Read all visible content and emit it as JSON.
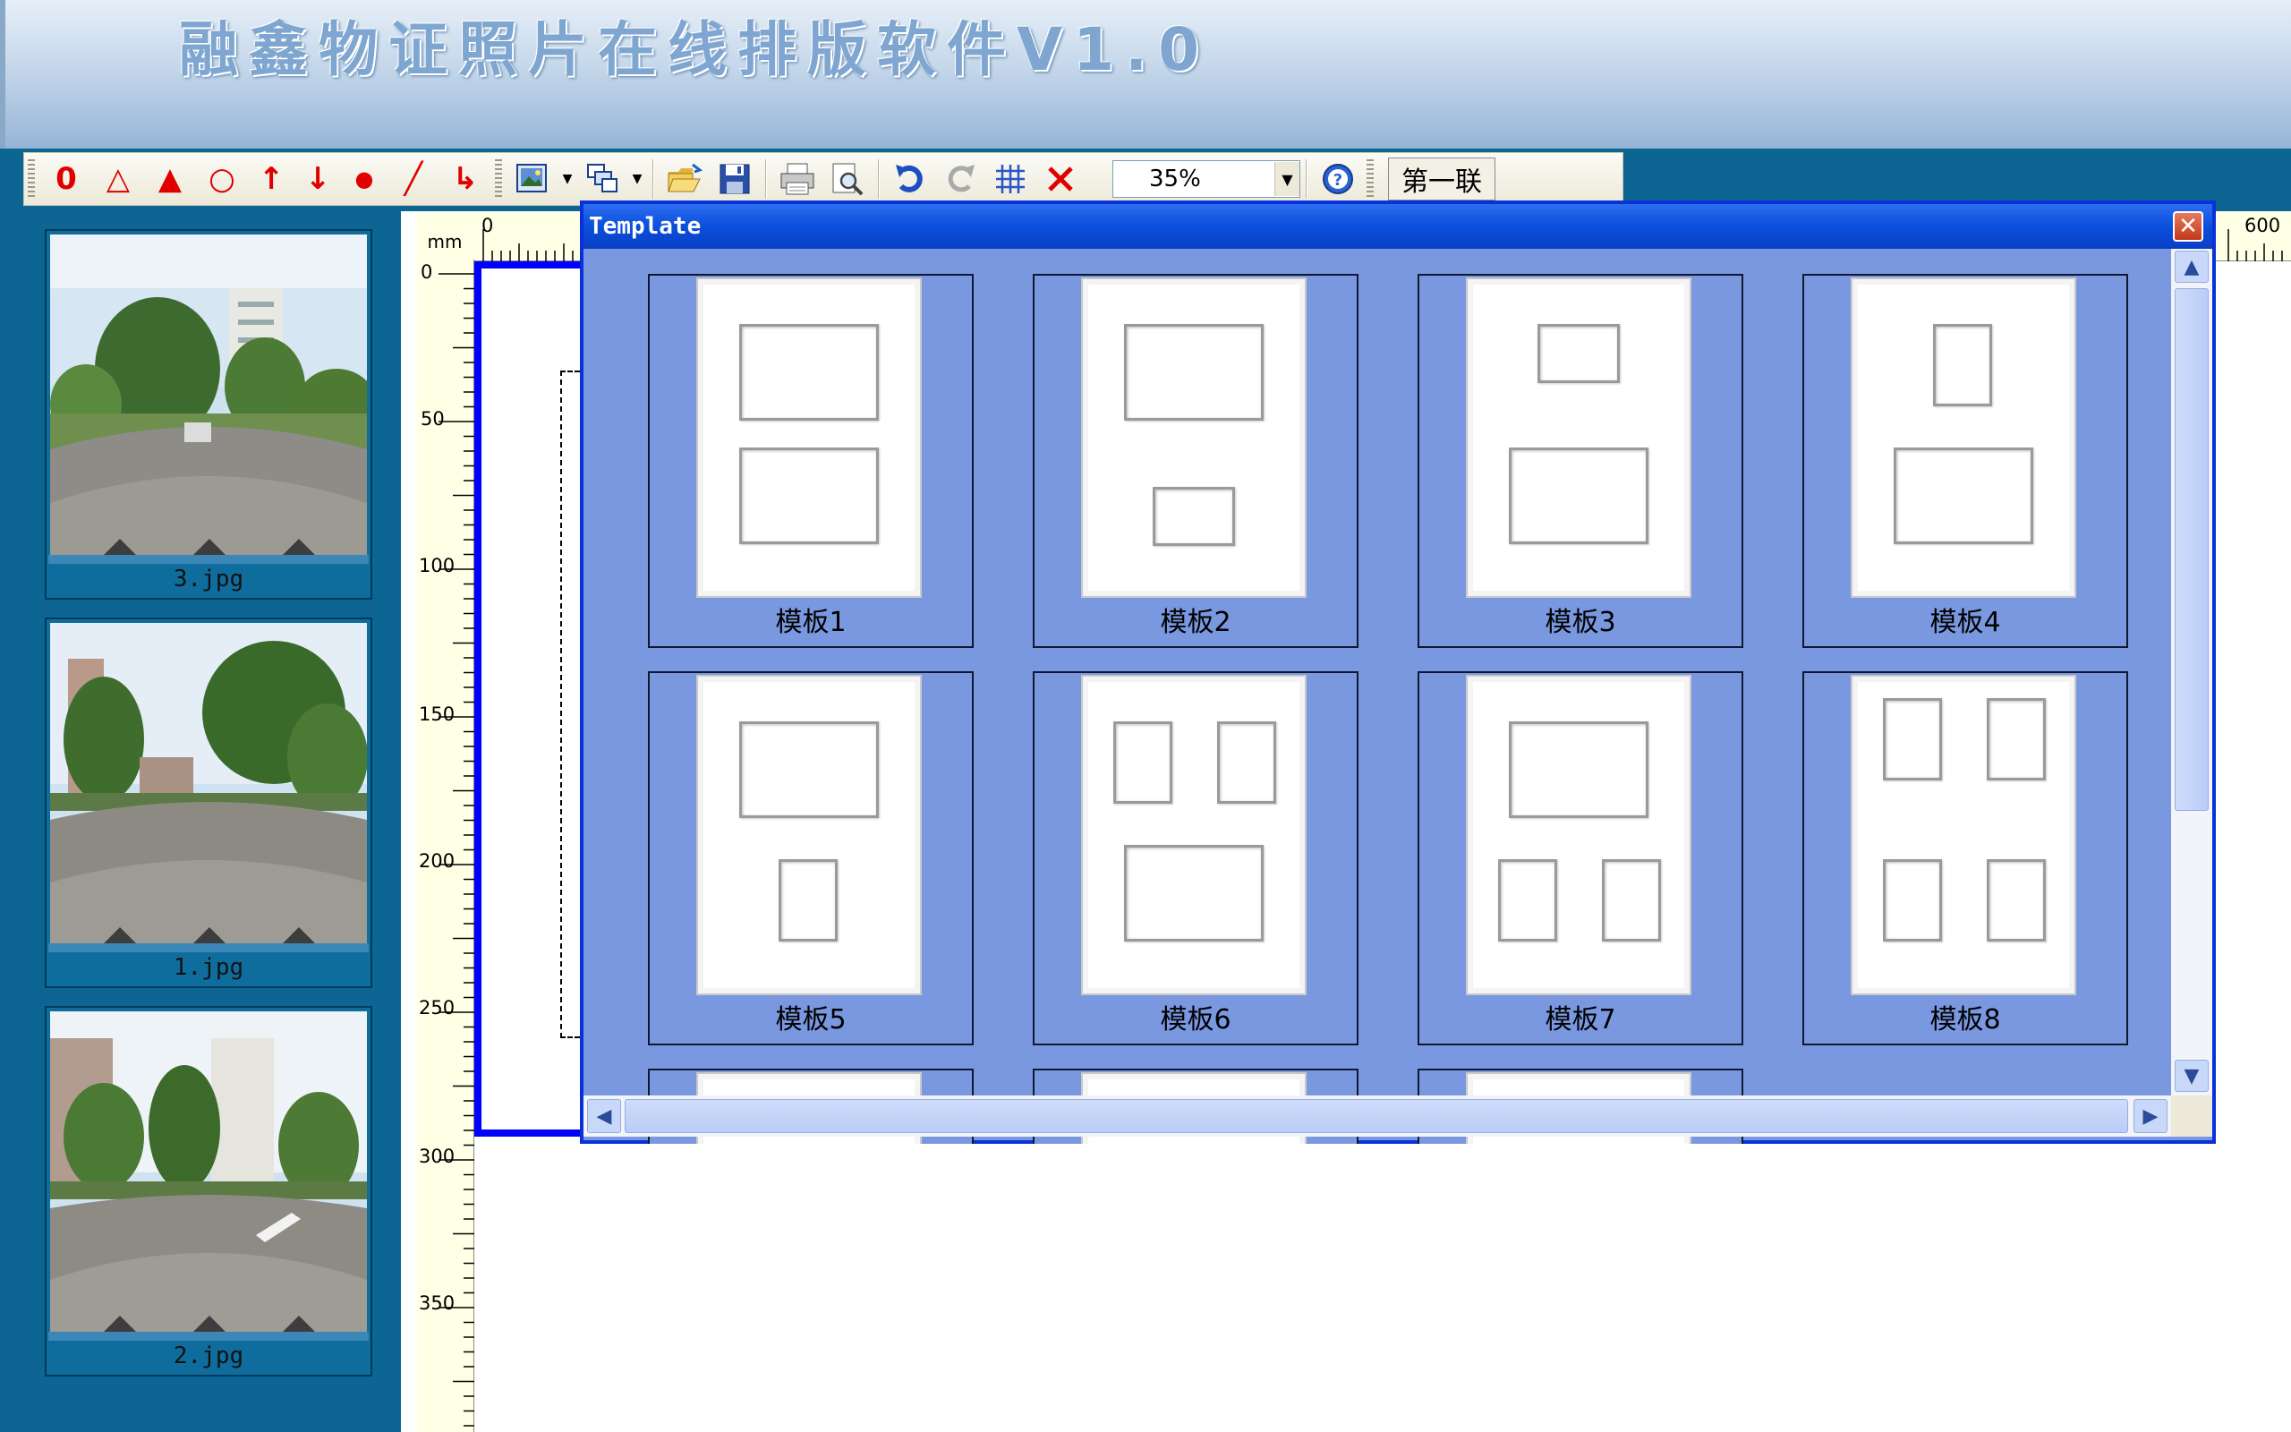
{
  "app": {
    "title": "融鑫物证照片在线排版软件V1.0"
  },
  "toolbar": {
    "shapes": [
      {
        "name": "ellipse-tool",
        "glyph": "0"
      },
      {
        "name": "triangle-outline-tool",
        "glyph": "△"
      },
      {
        "name": "triangle-filled-tool",
        "glyph": "▲"
      },
      {
        "name": "circle-tool",
        "glyph": "○"
      },
      {
        "name": "arrow-up-tool",
        "glyph": "↑"
      },
      {
        "name": "arrow-down-tool",
        "glyph": "↓"
      },
      {
        "name": "dot-tool",
        "glyph": "●"
      },
      {
        "name": "line-tool",
        "glyph": "╱"
      },
      {
        "name": "elbow-arrow-tool",
        "glyph": "↳"
      }
    ],
    "icons": [
      "insert-image-icon",
      "layer-order-icon",
      "open-folder-icon",
      "save-icon",
      "print-icon",
      "print-preview-icon",
      "undo-icon",
      "redo-icon",
      "grid-icon",
      "delete-icon",
      "help-icon"
    ],
    "zoom": "35%",
    "sheet_button": "第一联"
  },
  "thumbnails": [
    {
      "file": "3.jpg"
    },
    {
      "file": "1.jpg"
    },
    {
      "file": "2.jpg"
    }
  ],
  "ruler": {
    "unit": "mm",
    "h_labels": {
      "start": "0",
      "end": "600"
    },
    "v_labels": [
      "0",
      "50",
      "100",
      "150",
      "200",
      "250",
      "300",
      "350"
    ]
  },
  "dialog": {
    "title": "Template",
    "close_glyph": "✕",
    "templates": [
      {
        "label": "模板1"
      },
      {
        "label": "模板2"
      },
      {
        "label": "模板3"
      },
      {
        "label": "模板4"
      },
      {
        "label": "模板5"
      },
      {
        "label": "模板6"
      },
      {
        "label": "模板7"
      },
      {
        "label": "模板8"
      }
    ]
  },
  "colors": {
    "app_bg": "#0d6594",
    "dialog_bg": "#7a98e0",
    "title_bar": "#0a4fdc",
    "accent_red": "#e00000"
  }
}
